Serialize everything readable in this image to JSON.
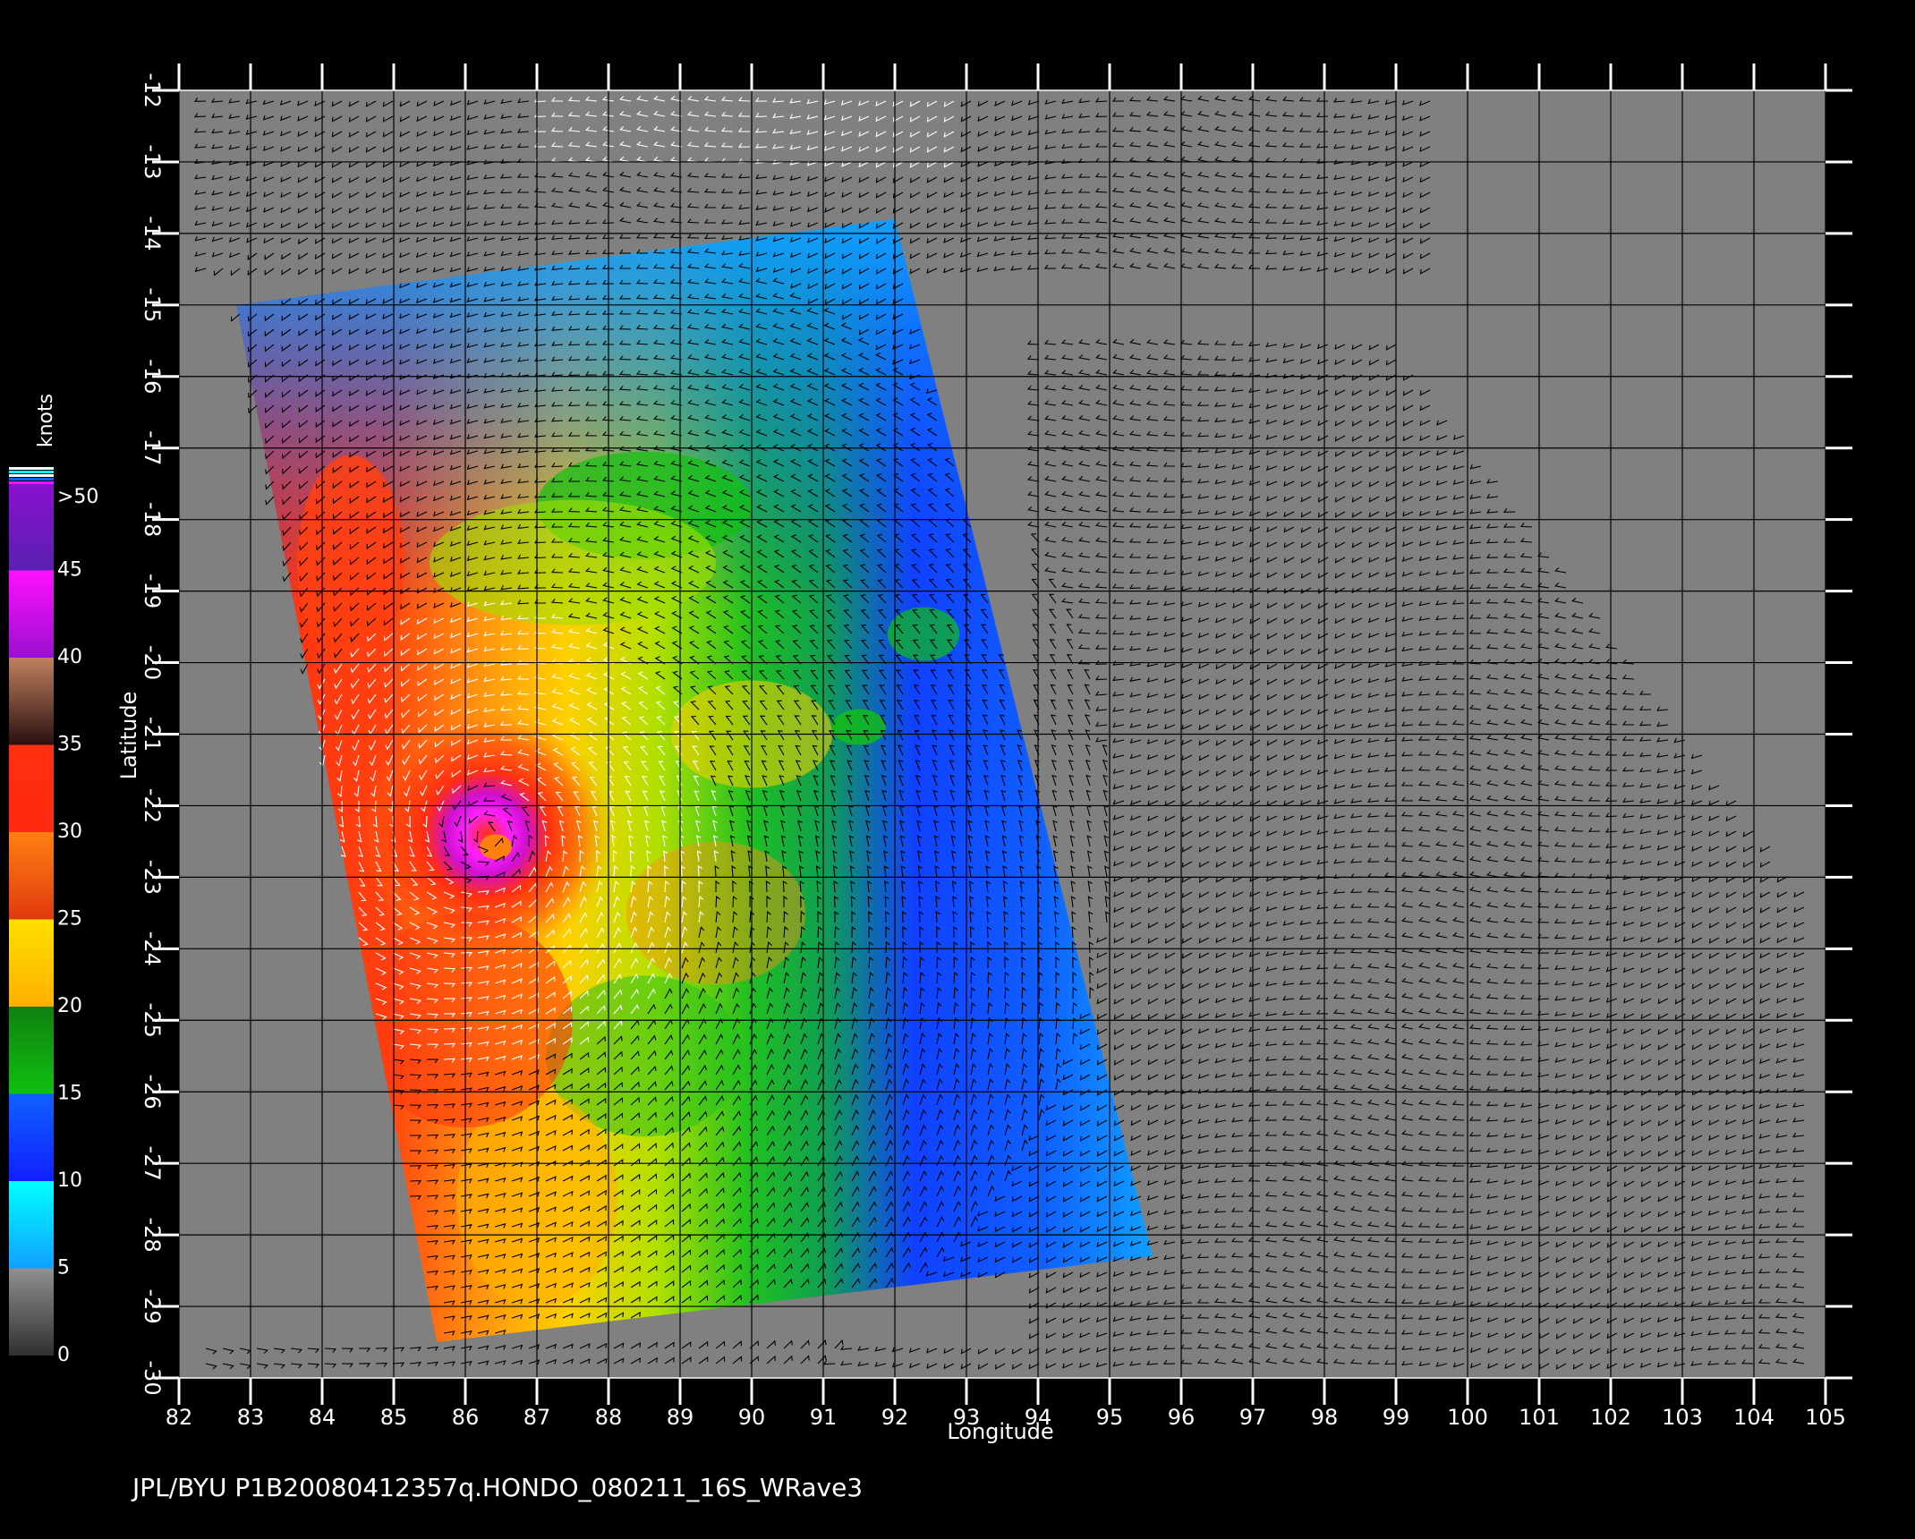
{
  "map": {
    "footer": "JPL/BYU  P1B20080412357q.HONDO_080211_16S_WRave3",
    "xlabel": "Longitude",
    "ylabel": "Latitude",
    "lon_range": [
      82,
      105
    ],
    "lat_range": [
      -30,
      -12
    ],
    "lon_ticks": [
      "82",
      "83",
      "84",
      "85",
      "86",
      "87",
      "88",
      "89",
      "90",
      "91",
      "92",
      "93",
      "94",
      "95",
      "96",
      "97",
      "98",
      "99",
      "100",
      "101",
      "102",
      "103",
      "104",
      "105"
    ],
    "lat_ticks": [
      "-12",
      "-13",
      "-14",
      "-15",
      "-16",
      "-17",
      "-18",
      "-19",
      "-20",
      "-21",
      "-22",
      "-23",
      "-24",
      "-25",
      "-26",
      "-27",
      "-28",
      "-29",
      "-30"
    ],
    "background_color": "#808080",
    "storm_center": {
      "lon": 86.3,
      "lat": -22.4
    },
    "swath_corners": [
      {
        "lon": 82.8,
        "lat": -15.0
      },
      {
        "lon": 92.0,
        "lat": -13.8
      },
      {
        "lon": 95.6,
        "lat": -28.3
      },
      {
        "lon": 85.6,
        "lat": -29.5
      }
    ]
  },
  "colorbar": {
    "unit": "knots",
    "labels": [
      ">50",
      "45",
      "40",
      "35",
      "30",
      "25",
      "20",
      "15",
      "10",
      "5",
      "0"
    ],
    "bands": [
      {
        "from": 45,
        "to": 50,
        "colors": [
          "#5a20b0",
          "#8a10d0"
        ]
      },
      {
        "from": 40,
        "to": 45,
        "colors": [
          "#9a10d0",
          "#ff10ff"
        ]
      },
      {
        "from": 35,
        "to": 40,
        "colors": [
          "#2a1010",
          "#c08060"
        ]
      },
      {
        "from": 30,
        "to": 35,
        "colors": [
          "#ff2a10",
          "#ff3010"
        ]
      },
      {
        "from": 25,
        "to": 30,
        "colors": [
          "#e03a10",
          "#ff8010"
        ]
      },
      {
        "from": 20,
        "to": 25,
        "colors": [
          "#ffb000",
          "#ffe000"
        ]
      },
      {
        "from": 15,
        "to": 20,
        "colors": [
          "#10c010",
          "#108010"
        ]
      },
      {
        "from": 10,
        "to": 15,
        "colors": [
          "#1020ff",
          "#1060ff"
        ]
      },
      {
        "from": 5,
        "to": 10,
        "colors": [
          "#10a0ff",
          "#00ffff"
        ]
      },
      {
        "from": 0,
        "to": 5,
        "colors": [
          "#303030",
          "#909090"
        ]
      }
    ]
  }
}
